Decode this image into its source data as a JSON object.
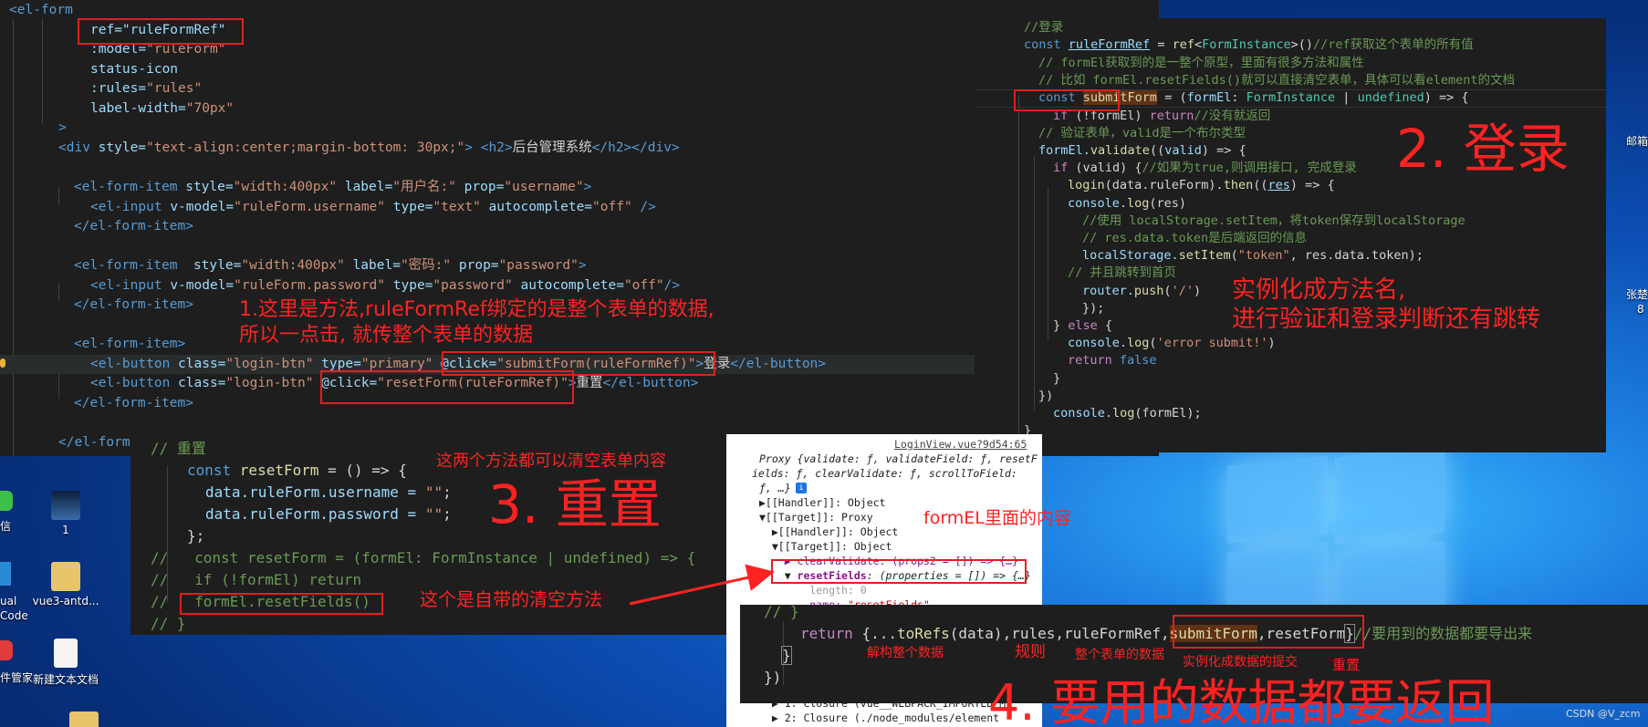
{
  "desktop": {
    "icons": [
      {
        "label": "1"
      },
      {
        "label": "vue3-antd..."
      },
      {
        "label": "新建文本文档"
      }
    ],
    "left_edge": [
      "信",
      "ual",
      "Code",
      "件管家"
    ],
    "right_edge": [
      "邮箱",
      "张楚",
      "8"
    ],
    "watermark": "CSDN @V_zcm"
  },
  "template_code": {
    "l1_tag": "<el-form",
    "l2_ref": "ref=\"ruleFormRef\"",
    "l3_attr": ":model=",
    "l3_val": "\"ruleForm\"",
    "l4_attr": "status-icon",
    "l5_attr": ":rules=",
    "l5_val": "\"rules\"",
    "l6_attr": "label-width=",
    "l6_val": "\"70px\"",
    "l7": ">",
    "l8_a": "<div ",
    "l8_b": "style=",
    "l8_c": "\"text-align:center;margin-bottom: 30px;\"",
    "l8_d": "> ",
    "l8_e": "<h2>",
    "l8_f": "后台管理系统",
    "l8_g": "</h2></div>",
    "l10_a": "<el-form-item ",
    "l10_b": "style=",
    "l10_c": "\"width:400px\"",
    "l10_d": " label=",
    "l10_e": "\"用户名:\"",
    "l10_f": " prop=",
    "l10_g": "\"username\"",
    "l10_h": ">",
    "l11_a": "<el-input ",
    "l11_b": "v-model=",
    "l11_c": "\"ruleForm.username\"",
    "l11_d": " type=",
    "l11_e": "\"text\"",
    "l11_f": " autocomplete=",
    "l11_g": "\"off\"",
    "l11_h": " />",
    "l12": "</el-form-item>",
    "l14_a": "<el-form-item  ",
    "l14_b": "style=",
    "l14_c": "\"width:400px\"",
    "l14_d": " label=",
    "l14_e": "\"密码:\"",
    "l14_f": " prop=",
    "l14_g": "\"password\"",
    "l14_h": ">",
    "l15_a": "<el-input ",
    "l15_b": "v-model=",
    "l15_c": "\"ruleForm.password\"",
    "l15_d": " type=",
    "l15_e": "\"password\"",
    "l15_f": " autocomplete=",
    "l15_g": "\"off\"",
    "l15_h": "/>",
    "l16": "</el-form-item>",
    "l18": "<el-form-item>",
    "l19_a": "<el-button ",
    "l19_b": "class=",
    "l19_c": "\"login-btn\"",
    "l19_d": " type=",
    "l19_e": "\"primary\"",
    "l19_f": " @click=",
    "l19_g": "\"submitForm(ruleFormRef)\"",
    "l19_h": ">",
    "l19_i": "登录",
    "l19_j": "</el-button>",
    "l20_a": "<el-button ",
    "l20_b": "class=",
    "l20_c": "\"login-btn\"",
    "l20_f": " @click=",
    "l20_g": "\"resetForm(ruleFormRef)\"",
    "l20_h": ">",
    "l20_i": "重置",
    "l20_j": "</el-button>",
    "l21": "</el-form-item>",
    "l23": "</el-form"
  },
  "script_code": {
    "c1": "//登录",
    "c2_a": "const ",
    "c2_b": "ruleFormRef",
    "c2_c": " = ",
    "c2_d": "ref",
    "c2_e": "<",
    "c2_f": "FormInstance",
    "c2_g": ">()",
    "c2_h": "//ref获取这个表单的所有值",
    "c3": "// formEl获取到的是一整个原型，里面有很多方法和属性",
    "c4": "// 比如 formEl.resetFields()就可以直接清空表单，具体可以看element的文档",
    "c5_a": "const ",
    "c5_b": "submitForm",
    "c5_c": " = (",
    "c5_d": "formEl",
    "c5_e": ": ",
    "c5_f": "FormInstance",
    "c5_g": " | ",
    "c5_h": "undefined",
    "c5_i": ") => {",
    "c6_a": "if ",
    "c6_b": "(!formEl) ",
    "c6_c": "return",
    "c6_d": "//没有就返回",
    "c7": "// 验证表单，valid是一个布尔类型",
    "c8_a": "formEl.",
    "c8_b": "validate",
    "c8_c": "((",
    "c8_d": "valid",
    "c8_e": ") => {",
    "c9_a": "if ",
    "c9_b": "(valid) {",
    "c9_c": "//如果为true,则调用接口, 完成登录",
    "c10_a": "login",
    "c10_b": "(data.ruleForm).",
    "c10_c": "then",
    "c10_d": "((",
    "c10_e": "res",
    "c10_f": ") => {",
    "c11_a": "console.",
    "c11_b": "log",
    "c11_c": "(res)",
    "c12": "//使用 localStorage.setItem，将token保存到localStorage",
    "c13": "// res.data.token是后端返回的信息",
    "c14_a": "localStorage.",
    "c14_b": "setItem",
    "c14_c": "(",
    "c14_d": "\"token\"",
    "c14_e": ", res.data.token);",
    "c15": "// 并且跳转到首页",
    "c16_a": "router.",
    "c16_b": "push",
    "c16_c": "(",
    "c16_d": "'/'",
    "c16_e": ")",
    "c17": "});",
    "c18_a": "} ",
    "c18_b": "else",
    "c18_c": " {",
    "c19_a": "console.",
    "c19_b": "log",
    "c19_c": "(",
    "c19_d": "'error submit!'",
    "c19_e": ")",
    "c20_a": "return ",
    "c20_b": "false",
    "c21": "}",
    "c22": "})",
    "c23_a": "console.",
    "c23_b": "log",
    "c23_c": "(formEl);",
    "c24": "}"
  },
  "reset_code": {
    "r1": "// 重置",
    "r2_a": "const ",
    "r2_b": "resetForm",
    "r2_c": " = () => {",
    "r3_a": "data.ruleForm.username = ",
    "r3_b": "\"\"",
    "r3_c": ";",
    "r4_a": "data.ruleForm.password = ",
    "r4_b": "\"\"",
    "r4_c": ";",
    "r5": "};",
    "r6": "//   const resetForm = (formEl: FormInstance | undefined) => {",
    "r7": "//   if (!formEl) return",
    "r8_a": "//   ",
    "r8_b": "formEl.resetFields()",
    "r9": "// }"
  },
  "return_code": {
    "a": "// }",
    "b_a": "return ",
    "b_b": "{...",
    "b_c": "toRefs",
    "b_d": "(data),rules,ruleFormRef,",
    "b_e": "submitForm",
    "b_f": ",resetForm",
    "b_g": "}",
    "b_h": "//要用到的数据都要导出来",
    "c": "}",
    "d": "})"
  },
  "devtools": {
    "link": "LoginView.vue?9d54:65",
    "line1": "Proxy {validate: ƒ, validateField: ƒ, resetF",
    "line2": "ields: ƒ, clearValidate: ƒ, scrollToField:",
    "line3": "ƒ, …}",
    "line4": "▶[[Handler]]: Object",
    "line5": "▼[[Target]]: Proxy",
    "line6": "  ▶[[Handler]]: Object",
    "line7": "  ▼[[Target]]: Object",
    "line8": "    ▶ clearValidate: (props2 = []) => {…}",
    "line9_a": "    ▼ ",
    "line9_b": "resetFields",
    "line9_c": ": (properties = []) => {…}",
    "line10": "        length: 0",
    "line11_a": "        name: ",
    "line11_b": "\"resetFields\"",
    "line12": "  ▶ 1: Closure (vue__WEBPACK_IMPORTED_M",
    "line13": "  ▶ 2: Closure (./node_modules/element"
  },
  "annotations": {
    "note1_l1": "1.这里是方法,ruleFormRef绑定的是整个表单的数据,",
    "note1_l2": "所以一点击, 就传整个表单的数据",
    "note2_title": "2. 登录",
    "note2_l1": "实例化成方法名,",
    "note2_l2": "进行验证和登录判断还有跳转",
    "note3_top": "这两个方法都可以清空表单内容",
    "note3_title": "3. 重置",
    "note3_bottom": "这个是自带的清空方法",
    "note_formel": "formEL里面的内容",
    "note4_a": "解构整个数据",
    "note4_b": "规则",
    "note4_c": "整个表单的数据",
    "note4_d": "实例化成数据的提交",
    "note4_e": "重置",
    "note4_title": "4. 要用的数据都要返回"
  },
  "colors": {
    "annotation": "#ff2222",
    "editor_bg": "#1e1e1e",
    "desktop_accent": "#1d7fe0"
  }
}
